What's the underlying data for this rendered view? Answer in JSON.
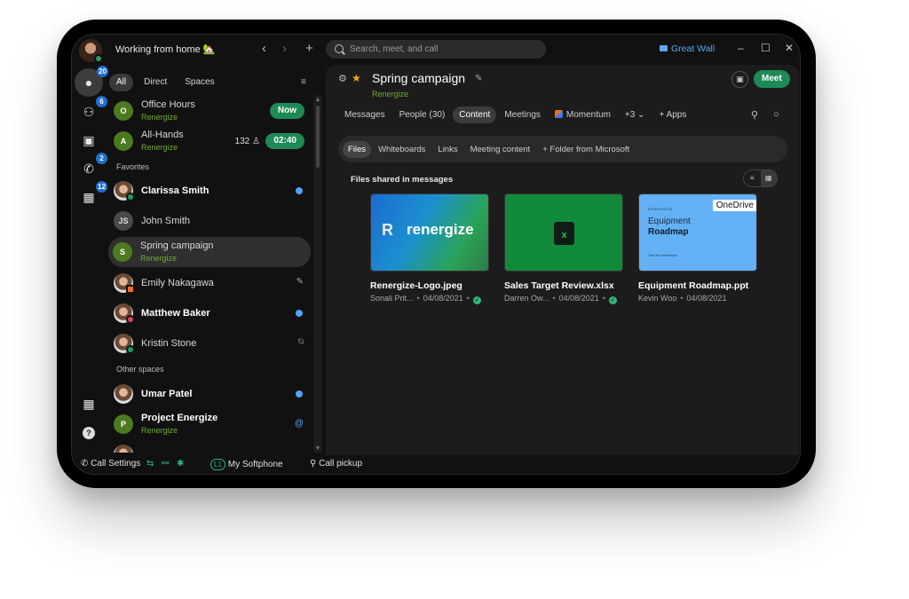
{
  "titlebar": {
    "status": "Working from home 🏡",
    "back_label": "‹",
    "forward_label": "›",
    "new_label": "+",
    "search_placeholder": "Search, meet, and call",
    "location": "Great Wall",
    "minimize": "–",
    "maximize": "☐",
    "close": "✕"
  },
  "rail": {
    "items": [
      {
        "name": "messaging",
        "icon": "chat-icon",
        "glyph": "💬",
        "badge": "20"
      },
      {
        "name": "teams",
        "icon": "teams-icon",
        "glyph": "👥",
        "badge": "6"
      },
      {
        "name": "contacts",
        "icon": "contacts-icon",
        "glyph": "📇",
        "badge": ""
      },
      {
        "name": "calling",
        "icon": "phone-icon",
        "glyph": "📞",
        "badge": "2"
      },
      {
        "name": "meetings",
        "icon": "calendar-icon",
        "glyph": "📅",
        "badge": "12"
      }
    ],
    "apps_glyph": "▦",
    "help_glyph": "?"
  },
  "filters": {
    "tabs": [
      "All",
      "Direct",
      "Spaces"
    ],
    "active": "All",
    "filter_glyph": "≡"
  },
  "list": {
    "meetings": [
      {
        "initial": "O",
        "name": "Office Hours",
        "sub": "Renergize",
        "action": "Now"
      },
      {
        "initial": "A",
        "name": "All-Hands",
        "sub": "Renergize",
        "count": "132",
        "count_icon": "👤",
        "action": "02:40"
      }
    ],
    "favorites_label": "Favorites",
    "favorites": [
      {
        "name": "Clarissa Smith",
        "bold": true,
        "unread": true,
        "presence": "#1e9e64"
      },
      {
        "initial": "JS",
        "name": "John Smith",
        "bold": false
      },
      {
        "initial": "S",
        "name": "Spring campaign",
        "sub": "Renergize",
        "selected": true
      },
      {
        "name": "Emily Nakagawa",
        "bold": false,
        "icon": "✎",
        "presence": "#f26b2a"
      },
      {
        "name": "Matthew Baker",
        "bold": true,
        "unread": true,
        "presence": "#e0405a"
      },
      {
        "name": "Kristin Stone",
        "bold": false,
        "icon": "🔕",
        "presence": "#1e9e64"
      }
    ],
    "other_label": "Other spaces",
    "other": [
      {
        "name": "Umar Patel",
        "bold": true,
        "unread": true
      },
      {
        "initial": "P",
        "name": "Project Energize",
        "sub": "Renergize",
        "bold": true,
        "mention": "@"
      }
    ]
  },
  "bottombar": {
    "call_settings": "Call Settings",
    "line_tag": "L1",
    "softphone": "My Softphone",
    "call_pickup": "Call pickup"
  },
  "space": {
    "title": "Spring campaign",
    "team": "Renergize",
    "meet_label": "Meet",
    "tabs": [
      "Messages",
      "People (30)",
      "Content",
      "Meetings",
      "Momentum",
      "+3",
      "Apps"
    ],
    "active_tab": "Content",
    "subtabs": [
      "Files",
      "Whiteboards",
      "Links",
      "Meeting content",
      "Folder from Microsoft"
    ],
    "active_subtab": "Files",
    "files_heading": "Files shared in messages",
    "files": [
      {
        "name": "Renergize-Logo.jpeg",
        "author": "Sonali Prit...",
        "date": "04/08/2021",
        "verified": true,
        "thumb_text": "renergize"
      },
      {
        "name": "Sales Target Review.xlsx",
        "author": "Darren Ow...",
        "date": "04/08/2021",
        "verified": true,
        "thumb_text": "x"
      },
      {
        "name": "Equipment Roadmap.ppt",
        "author": "Kevin Woo",
        "date": "04/08/2021",
        "verified": false,
        "thumb_small": "RENERGIZE",
        "thumb_line1": "Equipment",
        "thumb_line2": "Roadmap",
        "thumb_foot": "Join the adventure",
        "tag": "OneDrive"
      }
    ]
  },
  "colors": {
    "accent_green": "#1e8a55",
    "team_green": "#6fae2c",
    "badge_blue": "#1f6fd1",
    "unread_blue": "#4da3ff",
    "star": "#f5a623"
  }
}
